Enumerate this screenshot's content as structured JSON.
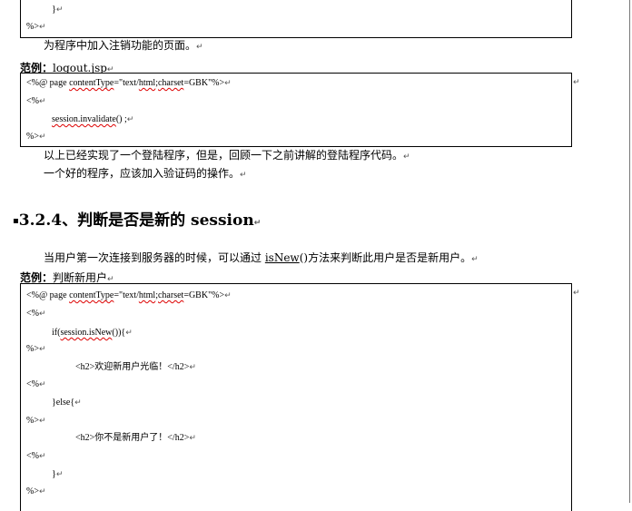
{
  "top_code_tail": {
    "line1": "}",
    "line2": "%>"
  },
  "intro_logout": "为程序中加入注销功能的页面。",
  "example1": {
    "label": "范例：",
    "file": "logout.jsp",
    "code": {
      "l1_pre": "<%@ page ",
      "l1_ct": "contentType",
      "l1_mid": "=\"text/",
      "l1_html": "html",
      "l1_sep": ";",
      "l1_charset": "charset",
      "l1_end": "=GBK\"%>",
      "l2": "<%",
      "l3_fn": "session.invalidate",
      "l3_rest": "() ;",
      "l4": "%>"
    }
  },
  "summary": {
    "line1": "以上已经实现了一个登陆程序，但是，回顾一下之前讲解的登陆程序代码。",
    "line2": "一个好的程序，应该加入验证码的操作。"
  },
  "section": {
    "number": "3.2.4",
    "title": "、判断是否是新的 session"
  },
  "intro_new": {
    "pre": "当用户第一次连接到服务器的时候，可以通过 ",
    "method": "isNew",
    "post": "()方法来判断此用户是否是新用户。"
  },
  "example2": {
    "label": "范例：",
    "title": "判断新用户",
    "code": {
      "l1_pre": "<%@ page ",
      "l1_ct": "contentType",
      "l1_mid": "=\"text/",
      "l1_html": "html",
      "l1_sep": ";",
      "l1_charset": "charset",
      "l1_end": "=GBK\"%>",
      "l2": "<%",
      "l3_pre": "if(",
      "l3_fn": "session.isNew",
      "l3_post": "()){",
      "l4": "%>",
      "l5": "<h2>欢迎新用户光临！</h2>",
      "l6": "<%",
      "l7": "}else{",
      "l8": "%>",
      "l9": "<h2>你不是新用户了！</h2>",
      "l10": "<%",
      "l11": "}",
      "l12": "%>"
    }
  },
  "marks": {
    "para": "↵"
  }
}
